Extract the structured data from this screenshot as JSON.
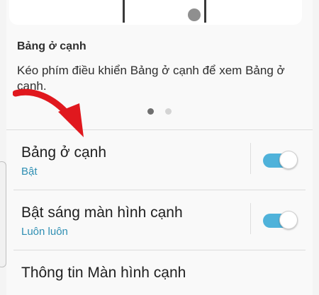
{
  "edge_panel_info": {
    "title": "Bảng ở cạnh",
    "description": "Kéo phím điều khiển Bảng ở cạnh để xem Bảng ở cạnh."
  },
  "page_indicator": {
    "total": 2,
    "active_index": 0
  },
  "settings": [
    {
      "title": "Bảng ở cạnh",
      "subtitle": "Bật",
      "toggle_on": true
    },
    {
      "title": "Bật sáng màn hình cạnh",
      "subtitle": "Luôn luôn",
      "toggle_on": true
    },
    {
      "title": "Thông tin Màn hình cạnh"
    }
  ],
  "colors": {
    "accent": "#4fb2da",
    "subtitle": "#2f8fb3",
    "arrow": "#e0181e"
  },
  "icons": {
    "annotation": "red-curved-arrow"
  }
}
